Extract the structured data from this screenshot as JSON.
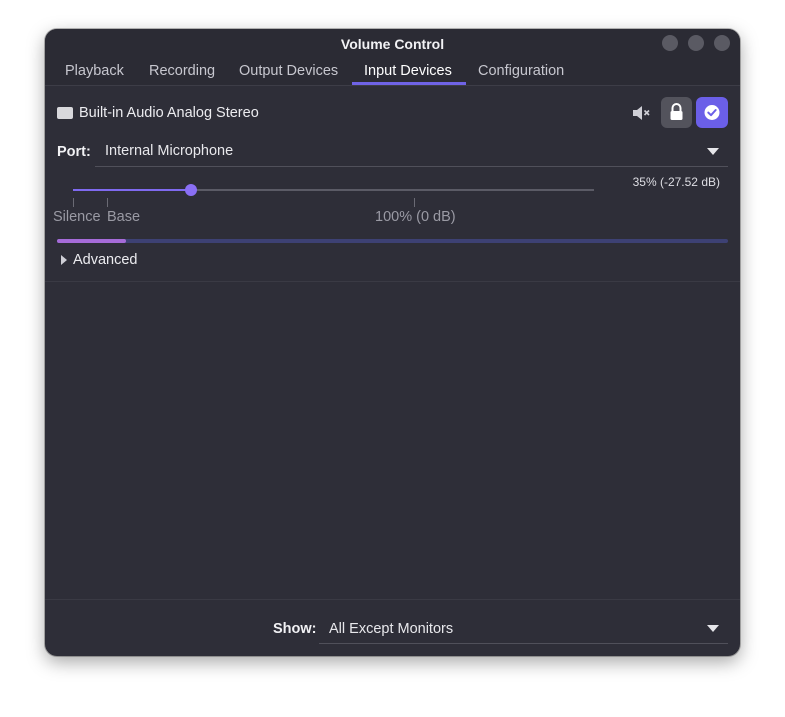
{
  "window": {
    "title": "Volume Control"
  },
  "tabs": [
    {
      "label": "Playback",
      "active": false
    },
    {
      "label": "Recording",
      "active": false
    },
    {
      "label": "Output Devices",
      "active": false
    },
    {
      "label": "Input Devices",
      "active": true
    },
    {
      "label": "Configuration",
      "active": false
    }
  ],
  "device": {
    "name": "Built-in Audio Analog Stereo",
    "icons": {
      "device": "audio-card-icon",
      "mute": "speaker-muted-icon",
      "lock": "lock-icon",
      "default": "check-circle-icon"
    },
    "port_label": "Port:",
    "port_value": "Internal Microphone",
    "volume_readout": "35% (-27.52 dB)",
    "volume_fraction": 0.227,
    "scale_labels": {
      "silence": "Silence",
      "base": "Base",
      "full": "100% (0 dB)"
    },
    "level_fraction": 0.103,
    "advanced_label": "Advanced"
  },
  "footer": {
    "show_label": "Show:",
    "show_value": "All Except Monitors"
  },
  "colors": {
    "accent": "#6b5fe8",
    "background": "#2e2e38",
    "level": "#a56bd8"
  }
}
